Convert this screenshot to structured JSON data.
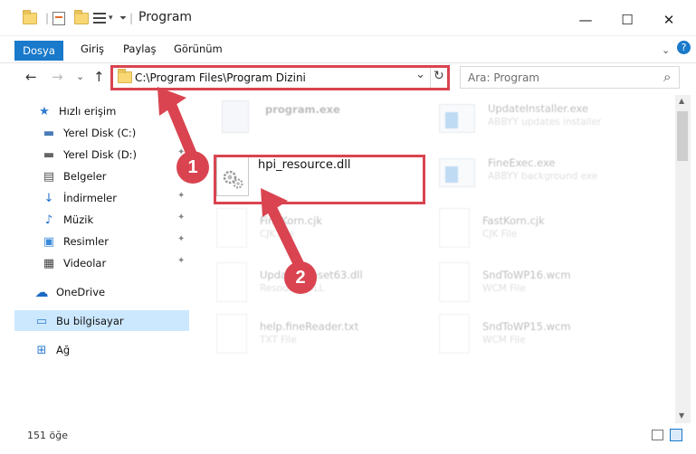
{
  "window": {
    "title": "Program",
    "minimize": "—",
    "maximize": "☐",
    "close": "✕"
  },
  "ribbon": {
    "tabs": [
      "Dosya",
      "Giriş",
      "Paylaş",
      "Görünüm"
    ],
    "help": "?"
  },
  "nav": {
    "back": "←",
    "forward": "→",
    "recent": "⌄",
    "up": "↑",
    "address": "C:\\Program Files\\Program Dizini",
    "dropdown": "⌄",
    "refresh": "↻",
    "search_placeholder": "Ara: Program",
    "search_icon": "⌕"
  },
  "sidebar": {
    "items": [
      {
        "label": "Hızlı erişim",
        "icon": "star-icon",
        "glyph": "★",
        "color": "#2f7bd1"
      },
      {
        "label": "Yerel Disk (C:)",
        "icon": "drive-icon",
        "glyph": "▬",
        "color": "#4a7bb7"
      },
      {
        "label": "Yerel Disk (D:)",
        "icon": "drive-icon",
        "glyph": "▬",
        "color": "#666666"
      },
      {
        "label": "Belgeler",
        "icon": "documents-icon",
        "glyph": "▤",
        "color": "#555555"
      },
      {
        "label": "İndirmeler",
        "icon": "downloads-icon",
        "glyph": "↓",
        "color": "#1f6fc9"
      },
      {
        "label": "Müzik",
        "icon": "music-icon",
        "glyph": "♪",
        "color": "#1f6fc9"
      },
      {
        "label": "Resimler",
        "icon": "pictures-icon",
        "glyph": "▣",
        "color": "#3b8ad9"
      },
      {
        "label": "Videolar",
        "icon": "videos-icon",
        "glyph": "▦",
        "color": "#444444"
      },
      {
        "label": "OneDrive",
        "icon": "onedrive-icon",
        "glyph": "☁",
        "color": "#1a6ac4"
      },
      {
        "label": "Bu bilgisayar",
        "icon": "computer-icon",
        "glyph": "▭",
        "color": "#2e7bd1"
      },
      {
        "label": "Ağ",
        "icon": "network-icon",
        "glyph": "⊞",
        "color": "#2e7bd1"
      }
    ],
    "pin": "📌"
  },
  "files": {
    "col1": [
      {
        "name": "program.exe",
        "type": ""
      },
      {
        "name": "hpi_resource.dll",
        "type": ""
      },
      {
        "name": "FineKorn.cjk",
        "type": "CJK File"
      },
      {
        "name": "UpdateAppset63.dll",
        "type": "Resource DLL"
      },
      {
        "name": "help.fineReader.txt",
        "type": "TXT File"
      }
    ],
    "col2": [
      {
        "name": "UpdateInstaller.exe",
        "type": "ABBYY updates installer"
      },
      {
        "name": "FineExec.exe",
        "type": "ABBYY background exe"
      },
      {
        "name": "FastKorn.cjk",
        "type": "CJK File"
      },
      {
        "name": "SndToWP16.wcm",
        "type": "WCM File"
      },
      {
        "name": "SndToWP15.wcm",
        "type": "WCM File"
      }
    ]
  },
  "callouts": {
    "one": "1",
    "two": "2"
  },
  "status": {
    "count": "151 öğe"
  },
  "colors": {
    "accent": "#1979ca",
    "highlight": "#d94450",
    "selection": "#cce8ff"
  }
}
